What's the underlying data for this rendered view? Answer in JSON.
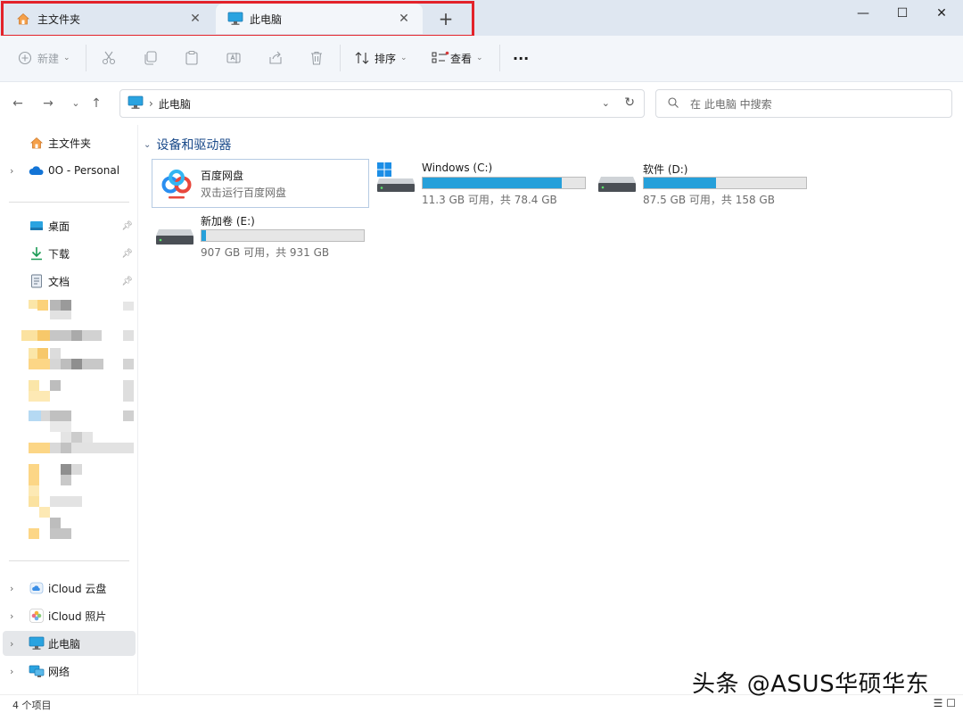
{
  "tabs": [
    {
      "label": "主文件夹",
      "icon": "home-icon",
      "active": false
    },
    {
      "label": "此电脑",
      "icon": "monitor-icon",
      "active": true
    }
  ],
  "window": {
    "minimize": "—",
    "maximize": "☐",
    "close": "✕"
  },
  "toolbar": {
    "new_label": "新建",
    "sort_label": "排序",
    "view_label": "查看",
    "more_label": "···"
  },
  "address": {
    "crumb": "此电脑",
    "search_placeholder": "在 此电脑 中搜索"
  },
  "sidebar": {
    "items": [
      {
        "label": "主文件夹",
        "icon": "home-icon"
      },
      {
        "label": "0O - Personal",
        "icon": "onedrive-cloud-icon"
      },
      {
        "label": "桌面",
        "icon": "desktop-folder-icon"
      },
      {
        "label": "下载",
        "icon": "download-icon"
      },
      {
        "label": "文档",
        "icon": "document-icon"
      },
      {
        "label": "iCloud 云盘",
        "icon": "icloud-drive-icon"
      },
      {
        "label": "iCloud 照片",
        "icon": "icloud-photos-icon"
      },
      {
        "label": "此电脑",
        "icon": "monitor-icon"
      },
      {
        "label": "网络",
        "icon": "network-icon"
      }
    ]
  },
  "main": {
    "group_title": "设备和驱动器",
    "baidu": {
      "name": "百度网盘",
      "subtitle": "双击运行百度网盘"
    },
    "drives": [
      {
        "name": "Windows (C:)",
        "info": "11.3 GB 可用，共 78.4 GB",
        "used_fraction": 0.856
      },
      {
        "name": "软件 (D:)",
        "info": "87.5 GB 可用，共 158 GB",
        "used_fraction": 0.446
      },
      {
        "name": "新加卷 (E:)",
        "info": "907 GB 可用，共 931 GB",
        "used_fraction": 0.026
      }
    ]
  },
  "status": {
    "count": "4 个项目"
  },
  "watermark": "头条 @ASUS华硕华东",
  "colors": {
    "accent": "#26a0da",
    "highlight": "#e3222a",
    "group_header": "#1a4a8a"
  }
}
